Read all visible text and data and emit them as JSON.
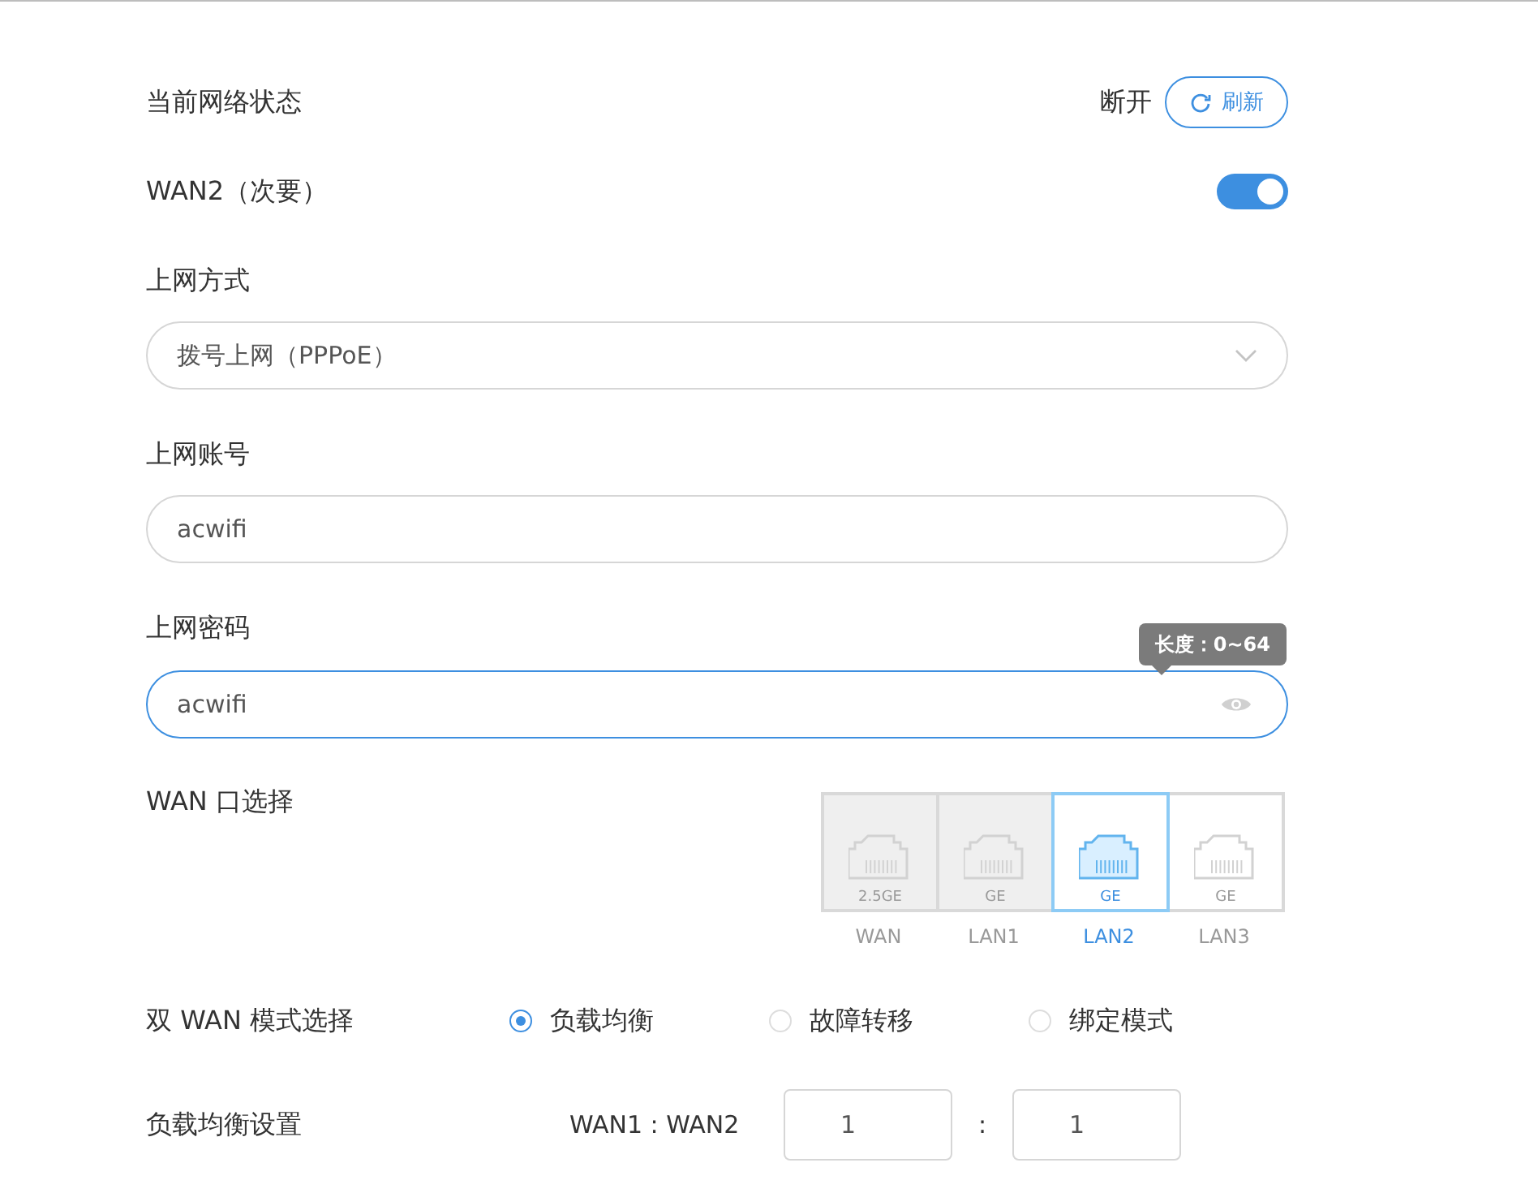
{
  "status": {
    "label": "当前网络状态",
    "value": "断开",
    "refresh_button": "刷新"
  },
  "wan2": {
    "label": "WAN2（次要）",
    "on": true
  },
  "connection_type": {
    "label": "上网方式",
    "value": "拨号上网（PPPoE）"
  },
  "account": {
    "label": "上网账号",
    "value": "acwifi"
  },
  "password": {
    "label": "上网密码",
    "value": "acwifi",
    "focused": true,
    "tooltip": "长度：0~64"
  },
  "wan_port": {
    "label": "WAN 口选择",
    "ports": [
      {
        "name": "WAN",
        "speed": "2.5GE",
        "disabled": true,
        "selected": false
      },
      {
        "name": "LAN1",
        "speed": "GE",
        "disabled": true,
        "selected": false
      },
      {
        "name": "LAN2",
        "speed": "GE",
        "disabled": false,
        "selected": true
      },
      {
        "name": "LAN3",
        "speed": "GE",
        "disabled": false,
        "selected": false
      }
    ]
  },
  "dual_wan_mode": {
    "label": "双 WAN 模式选择",
    "options": [
      {
        "label": "负载均衡",
        "selected": true
      },
      {
        "label": "故障转移",
        "selected": false
      },
      {
        "label": "绑定模式",
        "selected": false
      }
    ]
  },
  "load_balance": {
    "label": "负载均衡设置",
    "ratio_label": "WAN1 : WAN2",
    "wan1": "1",
    "separator": ":",
    "wan2": "1"
  }
}
